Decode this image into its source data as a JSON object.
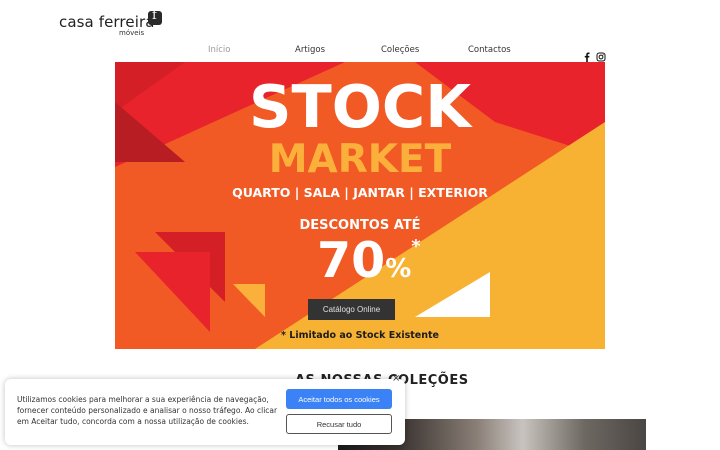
{
  "header": {
    "logo_text": "casa ferreira",
    "logo_subtext": "móveis"
  },
  "nav": {
    "items": [
      {
        "label": "Início",
        "active": true
      },
      {
        "label": "Artigos",
        "active": false
      },
      {
        "label": "Coleções",
        "active": false
      },
      {
        "label": "Contactos",
        "active": false
      }
    ]
  },
  "social": {
    "icons": [
      "facebook-icon",
      "instagram-icon"
    ]
  },
  "banner": {
    "headline": "STOCK",
    "subheadline": "MARKET",
    "rooms": "QUARTO | SALA | JANTAR | EXTERIOR",
    "discount_label": "DESCONTOS ATÉ",
    "discount_value": "70",
    "discount_symbol": "%",
    "discount_asterisk": "*",
    "button_label": "Catálogo Online",
    "note": "* Limitado ao Stock Existente",
    "colors": {
      "base": "#f15a24",
      "red": "#e8232b",
      "yellow": "#fbb03b",
      "dark": "#333333"
    }
  },
  "section": {
    "title": "AS NOSSAS COLEÇÕES"
  },
  "cookie": {
    "text": "Utilizamos cookies para melhorar a sua experiência de navegação, fornecer conteúdo personalizado e analisar o nosso tráfego. Ao clicar em Aceitar tudo, concorda com a nossa utilização de cookies.",
    "accept_label": "Aceitar todos os cookies",
    "reject_label": "Recusar tudo",
    "close_glyph": "×",
    "accent_color": "#3b82f6"
  }
}
